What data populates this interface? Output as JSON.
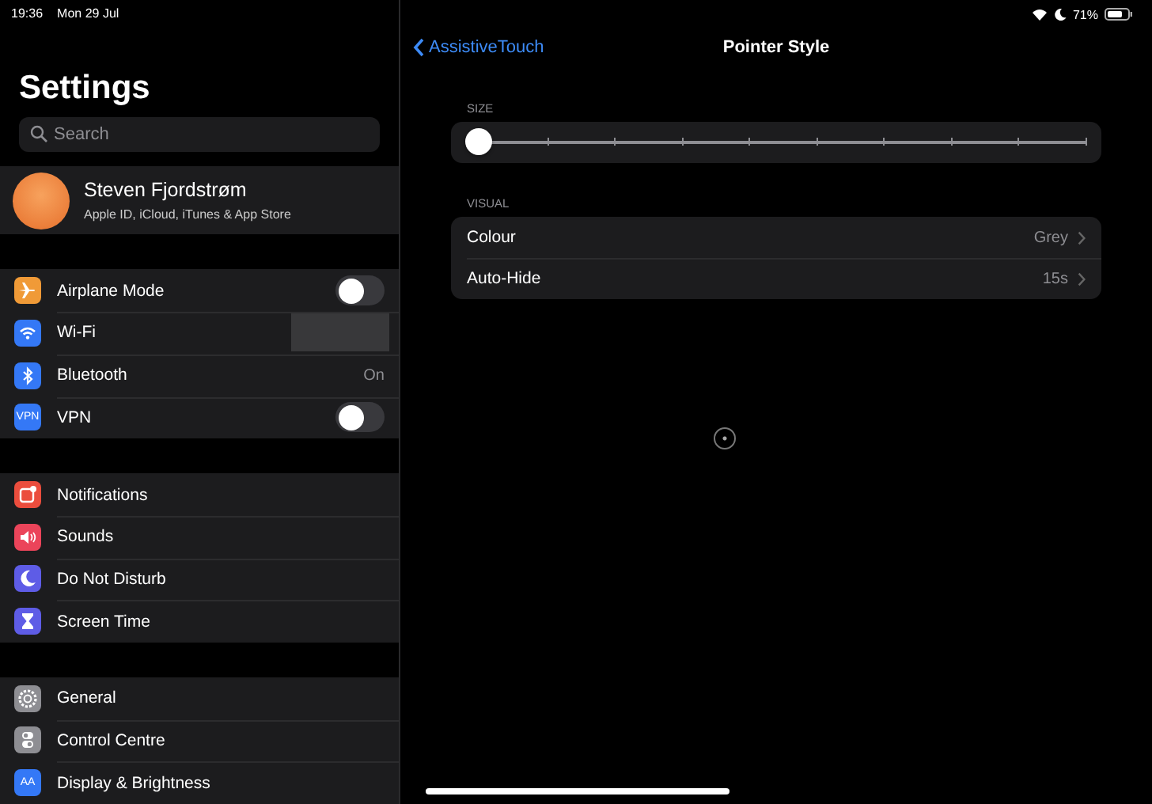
{
  "status_bar": {
    "time": "19:36",
    "date": "Mon 29 Jul",
    "battery": "71%"
  },
  "sidebar": {
    "title": "Settings",
    "search": {
      "placeholder": "Search"
    },
    "profile": {
      "name": "Steven Fjordstrøm",
      "subtitle": "Apple ID, iCloud, iTunes & App Store"
    },
    "groups": [
      [
        {
          "label": "Airplane Mode",
          "kind": "toggle",
          "on": false,
          "color": "#f09a37"
        },
        {
          "label": "Wi-Fi",
          "kind": "redacted",
          "color": "#3478f6"
        },
        {
          "label": "Bluetooth",
          "kind": "value",
          "value": "On",
          "color": "#3478f6"
        },
        {
          "label": "VPN",
          "kind": "toggle",
          "on": false,
          "icon_text": "VPN",
          "color": "#3478f6"
        }
      ],
      [
        {
          "label": "Notifications",
          "kind": "plain",
          "color": "#eb4d3d"
        },
        {
          "label": "Sounds",
          "kind": "plain",
          "color": "#eb445a"
        },
        {
          "label": "Do Not Disturb",
          "kind": "plain",
          "color": "#5e5ce6"
        },
        {
          "label": "Screen Time",
          "kind": "plain",
          "color": "#5e5ce6"
        }
      ],
      [
        {
          "label": "General",
          "kind": "plain",
          "color": "#8e8e93"
        },
        {
          "label": "Control Centre",
          "kind": "plain",
          "color": "#8e8e93"
        },
        {
          "label": "Display & Brightness",
          "kind": "plain",
          "icon_text": "AA",
          "color": "#3478f6"
        }
      ]
    ]
  },
  "detail": {
    "nav": {
      "back": "AssistiveTouch",
      "title": "Pointer Style"
    },
    "sections": [
      {
        "header": "SIZE",
        "kind": "slider",
        "level": 0
      },
      {
        "header": "VISUAL",
        "kind": "list",
        "rows": [
          {
            "label": "Colour",
            "value": "Grey"
          },
          {
            "label": "Auto-Hide",
            "value": "15s"
          }
        ]
      }
    ]
  }
}
